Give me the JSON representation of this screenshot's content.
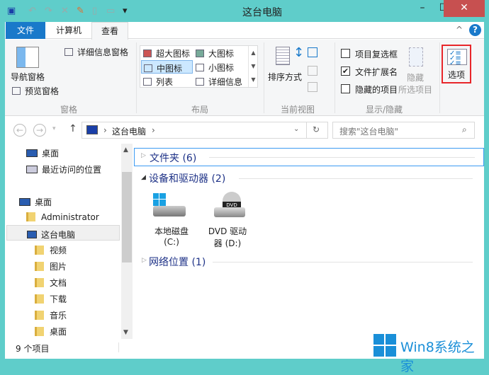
{
  "window": {
    "title": "这台电脑",
    "minimize": "–",
    "maximize": "☐",
    "close": "✕"
  },
  "qat": {
    "dropdown": "▾"
  },
  "tabs": [
    {
      "label": "文件"
    },
    {
      "label": "计算机"
    },
    {
      "label": "查看"
    }
  ],
  "ribbon": {
    "collapse": "^",
    "help": "?",
    "panes": {
      "nav_pane": "导航窗格",
      "preview_pane": "预览窗格",
      "details_pane": "详细信息窗格",
      "label": "窗格"
    },
    "layout": {
      "items": [
        "超大图标",
        "大图标",
        "中图标",
        "小图标",
        "列表",
        "详细信息"
      ],
      "selected": "中图标",
      "label": "布局"
    },
    "current_view": {
      "sort": "排序方式",
      "label": "当前视图"
    },
    "show_hide": {
      "item_checkboxes": "项目复选框",
      "file_extensions": "文件扩展名",
      "hidden_items": "隐藏的项目",
      "item_checkboxes_checked": false,
      "file_extensions_checked": true,
      "hidden_items_checked": false,
      "hide_selected_1": "隐藏",
      "hide_selected_2": "所选项目",
      "label": "显示/隐藏"
    },
    "options": {
      "label": "选项",
      "highlight": "#e8262a"
    }
  },
  "address": {
    "path": "这台电脑",
    "sep": "›",
    "search_placeholder": "搜索\"这台电脑\""
  },
  "nav": {
    "favorites": [
      {
        "label": "桌面"
      },
      {
        "label": "最近访问的位置"
      }
    ],
    "tree": [
      {
        "label": "桌面"
      },
      {
        "label": "Administrator"
      },
      {
        "label": "这台电脑"
      },
      {
        "label": "视频"
      },
      {
        "label": "图片"
      },
      {
        "label": "文档"
      },
      {
        "label": "下载"
      },
      {
        "label": "音乐"
      },
      {
        "label": "桌面"
      }
    ]
  },
  "content": {
    "groups": [
      {
        "label": "文件夹 (6)"
      },
      {
        "label": "设备和驱动器 (2)"
      },
      {
        "label": "网络位置 (1)"
      }
    ],
    "drives": [
      {
        "line1": "本地磁盘",
        "line2": "(C:)"
      },
      {
        "line1": "DVD 驱动",
        "line2": "器 (D:)",
        "badge": "DVD"
      }
    ]
  },
  "status": {
    "count": "9 个项目"
  },
  "watermark": {
    "text": "Win8系统之家"
  },
  "colors": {
    "frame": "#5fcdca",
    "file_tab": "#1979ca",
    "close": "#c75050",
    "header_text": "#1e3287",
    "selected": "#cce8ff"
  }
}
